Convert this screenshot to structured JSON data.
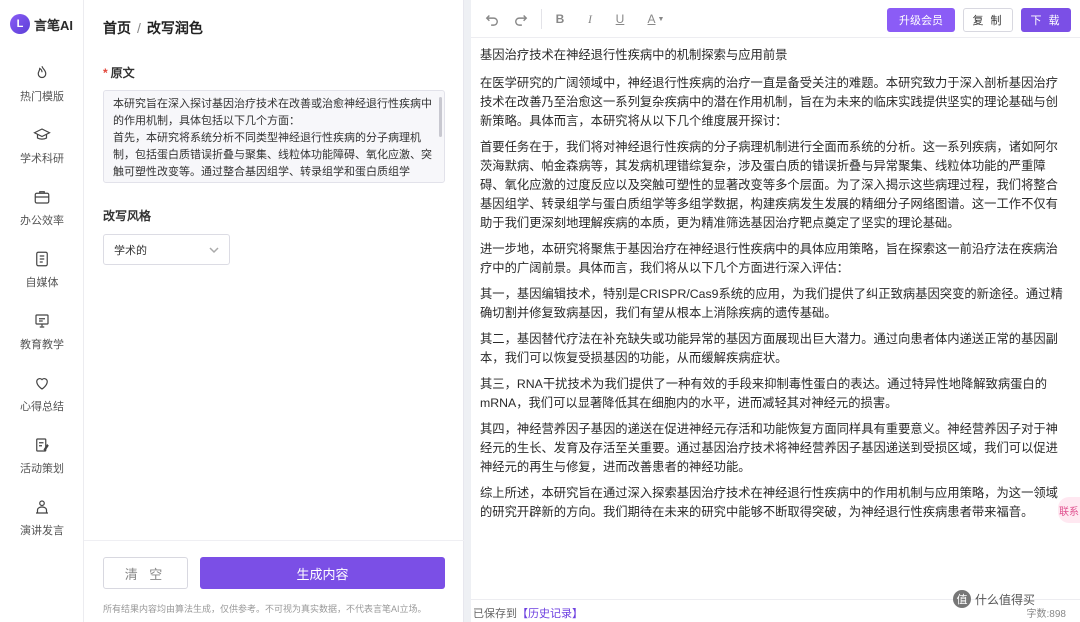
{
  "app": {
    "logo_text": "言笔AI",
    "logo_mark": "L",
    "accent_color": "#7b4fe6"
  },
  "sidebar": {
    "items": [
      {
        "label": "热门模版",
        "icon": "flame-icon"
      },
      {
        "label": "学术科研",
        "icon": "graduation-cap-icon"
      },
      {
        "label": "办公效率",
        "icon": "briefcase-icon"
      },
      {
        "label": "自媒体",
        "icon": "document-icon"
      },
      {
        "label": "教育教学",
        "icon": "presentation-icon"
      },
      {
        "label": "心得总结",
        "icon": "heart-icon"
      },
      {
        "label": "活动策划",
        "icon": "clipboard-pen-icon"
      },
      {
        "label": "演讲发言",
        "icon": "speaker-icon"
      }
    ]
  },
  "panel": {
    "breadcrumb_home": "首页",
    "breadcrumb_sep": "/",
    "breadcrumb_current": "改写润色",
    "source_label": "原文",
    "source_text": "本研究旨在深入探讨基因治疗技术在改善或治愈神经退行性疾病中的作用机制，具体包括以下几个方面：\n首先，本研究将系统分析不同类型神经退行性疾病的分子病理机制，包括蛋白质错误折叠与聚集、线粒体功能障碍、氧化应激、突触可塑性改变等。通过整合基因组学、转录组学和蛋白质组学",
    "style_label": "改写风格",
    "style_value": "学术的",
    "clear_label": "清 空",
    "generate_label": "生成内容",
    "disclaimer": "所有结果内容均由算法生成，仅供参考。不可视为真实数据，不代表言笔AI立场。"
  },
  "toolbar": {
    "undo_icon": "undo-icon",
    "redo_icon": "redo-icon",
    "bold": "B",
    "italic": "I",
    "underline": "U",
    "font_color": "A",
    "upgrade_label": "升级会员",
    "copy_label": "复 制",
    "download_label": "下 载"
  },
  "document": {
    "title": "基因治疗技术在神经退行性疾病中的机制探索与应用前景",
    "paragraphs": [
      "在医学研究的广阔领域中，神经退行性疾病的治疗一直是备受关注的难题。本研究致力于深入剖析基因治疗技术在改善乃至治愈这一系列复杂疾病中的潜在作用机制，旨在为未来的临床实践提供坚实的理论基础与创新策略。具体而言，本研究将从以下几个维度展开探讨：",
      "首要任务在于，我们将对神经退行性疾病的分子病理机制进行全面而系统的分析。这一系列疾病，诸如阿尔茨海默病、帕金森病等，其发病机理错综复杂，涉及蛋白质的错误折叠与异常聚集、线粒体功能的严重障碍、氧化应激的过度反应以及突触可塑性的显著改变等多个层面。为了深入揭示这些病理过程，我们将整合基因组学、转录组学与蛋白质组学等多组学数据，构建疾病发生发展的精细分子网络图谱。这一工作不仅有助于我们更深刻地理解疾病的本质，更为精准筛选基因治疗靶点奠定了坚实的理论基础。",
      "进一步地，本研究将聚焦于基因治疗在神经退行性疾病中的具体应用策略，旨在探索这一前沿疗法在疾病治疗中的广阔前景。具体而言，我们将从以下几个方面进行深入评估：",
      "其一，基因编辑技术，特别是CRISPR/Cas9系统的应用，为我们提供了纠正致病基因突变的新途径。通过精确切割并修复致病基因，我们有望从根本上消除疾病的遗传基础。",
      "其二，基因替代疗法在补充缺失或功能异常的基因方面展现出巨大潜力。通过向患者体内递送正常的基因副本，我们可以恢复受损基因的功能，从而缓解疾病症状。",
      "其三，RNA干扰技术为我们提供了一种有效的手段来抑制毒性蛋白的表达。通过特异性地降解致病蛋白的mRNA，我们可以显著降低其在细胞内的水平，进而减轻其对神经元的损害。",
      "其四，神经营养因子基因的递送在促进神经元存活和功能恢复方面同样具有重要意义。神经营养因子对于神经元的生长、发育及存活至关重要。通过基因治疗技术将神经营养因子基因递送到受损区域，我们可以促进神经元的再生与修复，进而改善患者的神经功能。",
      "综上所述，本研究旨在通过深入探索基因治疗技术在神经退行性疾病中的作用机制与应用策略，为这一领域的研究开辟新的方向。我们期待在未来的研究中能够不断取得突破，为神经退行性疾病患者带来福音。"
    ]
  },
  "status": {
    "saved_prefix": "已保存到",
    "history_link": "【历史记录】",
    "word_count": "字数:898"
  },
  "overlay": {
    "float_bubble": "联系",
    "watermark_badge": "值",
    "watermark_text": "什么值得买"
  }
}
